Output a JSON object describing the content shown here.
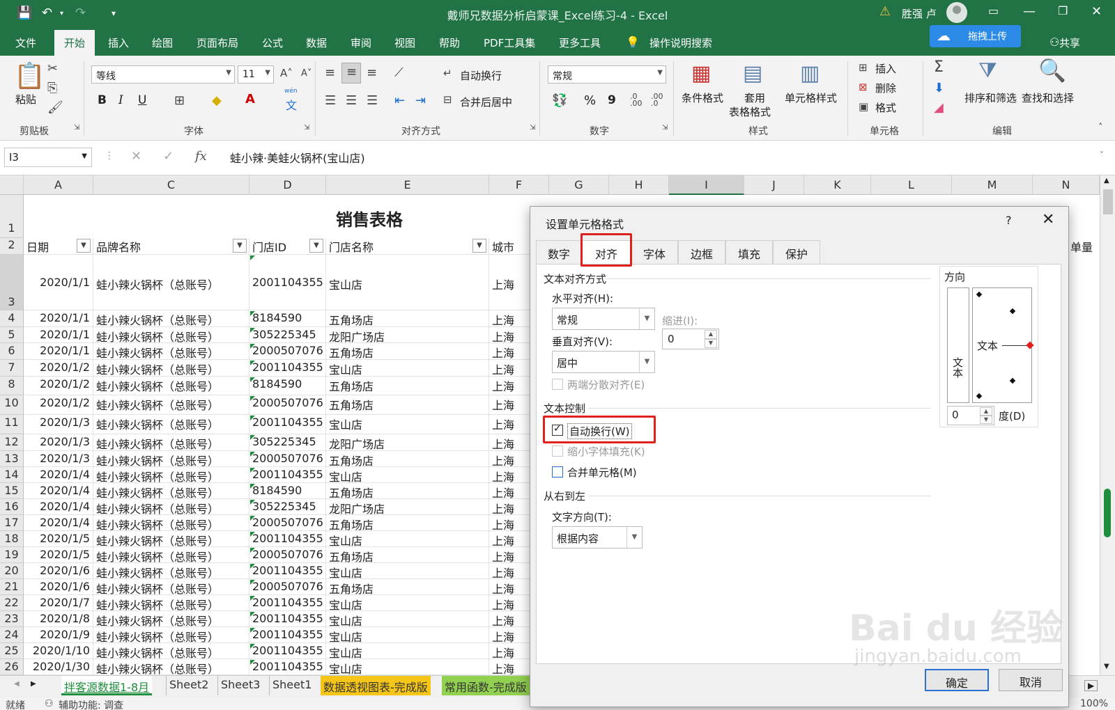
{
  "window": {
    "title": "戴师兄数据分析启蒙课_Excel练习-4  -  Excel",
    "user": "胜强 卢",
    "upload_label": "拖拽上传",
    "share_label": "共享",
    "minimize": "—",
    "restore": "❐",
    "close": "✕"
  },
  "menu": {
    "tabs": [
      "文件",
      "开始",
      "插入",
      "绘图",
      "页面布局",
      "公式",
      "数据",
      "审阅",
      "视图",
      "帮助",
      "PDF工具集",
      "更多工具",
      "操作说明搜索"
    ],
    "active": "开始"
  },
  "ribbon": {
    "clipboard": {
      "paste": "粘贴",
      "label": "剪贴板"
    },
    "font": {
      "name": "等线",
      "size": "11",
      "bold": "B",
      "italic": "I",
      "underline": "U",
      "label": "字体",
      "wen": "wén",
      "wen_char": "文"
    },
    "alignment": {
      "wrap": "自动换行",
      "merge": "合并后居中",
      "label": "对齐方式"
    },
    "number": {
      "format": "常规",
      "percent": "%",
      "comma": "9",
      "label": "数字",
      "inc": ".0\n.00",
      "dec": ".00\n.0"
    },
    "styles": {
      "conditional": "条件格式",
      "table_l1": "套用",
      "table_l2": "表格格式",
      "cell": "单元格样式",
      "label": "样式"
    },
    "cells": {
      "insert": "插入",
      "delete": "删除",
      "format": "格式",
      "label": "单元格"
    },
    "editing": {
      "sort": "排序和筛选",
      "find": "查找和选择",
      "label": "编辑"
    }
  },
  "formula_bar": {
    "name_box": "I3",
    "content": "蛙小辣·美蛙火锅杯(宝山店)",
    "cancel": "✕",
    "enter": "✓",
    "fx": "fx"
  },
  "grid": {
    "columns": [
      "A",
      "C",
      "D",
      "E",
      "F",
      "G",
      "H",
      "I",
      "J",
      "K",
      "L",
      "M",
      "N"
    ],
    "title": "销售表格",
    "headers": {
      "date": "日期",
      "brand": "品牌名称",
      "store_id": "门店ID",
      "store_name": "门店名称",
      "city": "城市",
      "n_partial": "单量"
    },
    "rows": [
      {
        "n": "3",
        "date": "2020/1/1",
        "brand": "蛙小辣火锅杯（总账号）",
        "id": "2001104355",
        "store": "宝山店",
        "city": "上海"
      },
      {
        "n": "4",
        "date": "2020/1/1",
        "brand": "蛙小辣火锅杯（总账号）",
        "id": "8184590",
        "store": "五角场店",
        "city": "上海"
      },
      {
        "n": "5",
        "date": "2020/1/1",
        "brand": "蛙小辣火锅杯（总账号）",
        "id": "305225345",
        "store": "龙阳广场店",
        "city": "上海"
      },
      {
        "n": "6",
        "date": "2020/1/1",
        "brand": "蛙小辣火锅杯（总账号）",
        "id": "2000507076",
        "store": "五角场店",
        "city": "上海"
      },
      {
        "n": "7",
        "date": "2020/1/2",
        "brand": "蛙小辣火锅杯（总账号）",
        "id": "2001104355",
        "store": "宝山店",
        "city": "上海"
      },
      {
        "n": "8",
        "date": "2020/1/2",
        "brand": "蛙小辣火锅杯（总账号）",
        "id": "8184590",
        "store": "五角场店",
        "city": "上海"
      },
      {
        "n": "10",
        "date": "2020/1/2",
        "brand": "蛙小辣火锅杯（总账号）",
        "id": "2000507076",
        "store": "五角场店",
        "city": "上海"
      },
      {
        "n": "11",
        "date": "2020/1/3",
        "brand": "蛙小辣火锅杯（总账号）",
        "id": "2001104355",
        "store": "宝山店",
        "city": "上海"
      },
      {
        "n": "12",
        "date": "2020/1/3",
        "brand": "蛙小辣火锅杯（总账号）",
        "id": "305225345",
        "store": "龙阳广场店",
        "city": "上海"
      },
      {
        "n": "13",
        "date": "2020/1/3",
        "brand": "蛙小辣火锅杯（总账号）",
        "id": "2000507076",
        "store": "五角场店",
        "city": "上海"
      },
      {
        "n": "14",
        "date": "2020/1/4",
        "brand": "蛙小辣火锅杯（总账号）",
        "id": "2001104355",
        "store": "宝山店",
        "city": "上海"
      },
      {
        "n": "15",
        "date": "2020/1/4",
        "brand": "蛙小辣火锅杯（总账号）",
        "id": "8184590",
        "store": "五角场店",
        "city": "上海"
      },
      {
        "n": "16",
        "date": "2020/1/4",
        "brand": "蛙小辣火锅杯（总账号）",
        "id": "305225345",
        "store": "龙阳广场店",
        "city": "上海"
      },
      {
        "n": "17",
        "date": "2020/1/4",
        "brand": "蛙小辣火锅杯（总账号）",
        "id": "2000507076",
        "store": "五角场店",
        "city": "上海"
      },
      {
        "n": "18",
        "date": "2020/1/5",
        "brand": "蛙小辣火锅杯（总账号）",
        "id": "2001104355",
        "store": "宝山店",
        "city": "上海"
      },
      {
        "n": "19",
        "date": "2020/1/5",
        "brand": "蛙小辣火锅杯（总账号）",
        "id": "2000507076",
        "store": "五角场店",
        "city": "上海"
      },
      {
        "n": "20",
        "date": "2020/1/6",
        "brand": "蛙小辣火锅杯（总账号）",
        "id": "2001104355",
        "store": "宝山店",
        "city": "上海"
      },
      {
        "n": "21",
        "date": "2020/1/6",
        "brand": "蛙小辣火锅杯（总账号）",
        "id": "2000507076",
        "store": "五角场店",
        "city": "上海"
      },
      {
        "n": "22",
        "date": "2020/1/7",
        "brand": "蛙小辣火锅杯（总账号）",
        "id": "2001104355",
        "store": "宝山店",
        "city": "上海"
      },
      {
        "n": "23",
        "date": "2020/1/8",
        "brand": "蛙小辣火锅杯（总账号）",
        "id": "2001104355",
        "store": "宝山店",
        "city": "上海"
      },
      {
        "n": "24",
        "date": "2020/1/9",
        "brand": "蛙小辣火锅杯（总账号）",
        "id": "2001104355",
        "store": "宝山店",
        "city": "上海"
      },
      {
        "n": "25",
        "date": "2020/1/10",
        "brand": "蛙小辣火锅杯（总账号）",
        "id": "2001104355",
        "store": "宝山店",
        "city": "上海"
      },
      {
        "n": "26",
        "date": "2020/1/30",
        "brand": "蛙小辣火锅杯（总账号）",
        "id": "2001104355",
        "store": "宝山店",
        "city": "上海"
      }
    ]
  },
  "sheets": {
    "tabs": [
      "拌客源数据1-8月",
      "Sheet2",
      "Sheet3",
      "Sheet1",
      "数据透视图表-完成版",
      "常用函数-完成版"
    ],
    "active": "拌客源数据1-8月"
  },
  "status": {
    "ready": "就绪",
    "accessibility": "辅助功能: 调查",
    "zoom": "100%"
  },
  "dialog": {
    "title": "设置单元格格式",
    "help": "?",
    "tabs": [
      "数字",
      "对齐",
      "字体",
      "边框",
      "填充",
      "保护"
    ],
    "active_tab": "对齐",
    "text_alignment": "文本对齐方式",
    "horizontal_label": "水平对齐(H):",
    "horizontal_value": "常规",
    "indent_label": "缩进(I):",
    "indent_value": "0",
    "vertical_label": "垂直对齐(V):",
    "vertical_value": "居中",
    "justify_distributed": "两端分散对齐(E)",
    "text_control": "文本控制",
    "wrap_text": "自动换行(W)",
    "wrap_checked": true,
    "shrink_to_fit": "缩小字体填充(K)",
    "merge_cells": "合并单元格(M)",
    "rtl": "从右到左",
    "text_direction_label": "文字方向(T):",
    "text_direction_value": "根据内容",
    "orientation": "方向",
    "orientation_vertical_text": "文本",
    "orientation_horizontal_text": "文本",
    "degrees_value": "0",
    "degrees_label": "度(D)",
    "ok": "确定",
    "cancel": "取消"
  },
  "watermark": {
    "brand": "Bai du 经验",
    "url": "jingyan.baidu.com"
  },
  "colors": {
    "excel_green": "#217346",
    "highlight_red": "#e0201c",
    "sheet_yellow": "#f5c518",
    "sheet_lightgreen": "#92d050"
  }
}
